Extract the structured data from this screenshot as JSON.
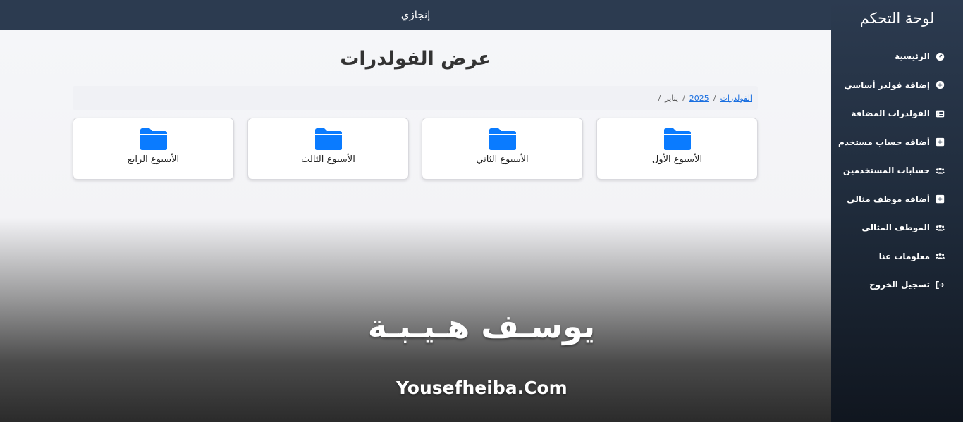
{
  "sidebar": {
    "title": "لوحة التحكم",
    "items": [
      {
        "label": "الرئيسية",
        "icon": "dashboard-icon"
      },
      {
        "label": "إضافة فولدر أساسي",
        "icon": "plus-circle-icon"
      },
      {
        "label": "الفولدرات المضافة",
        "icon": "list-icon"
      },
      {
        "label": "أضافه حساب مستخدم",
        "icon": "plus-square-icon"
      },
      {
        "label": "حسابات المستخدمين",
        "icon": "users-icon"
      },
      {
        "label": "أضافه موظف مثالي",
        "icon": "plus-square-icon"
      },
      {
        "label": "الموظف المثالي",
        "icon": "users-icon"
      },
      {
        "label": "معلومات عنا",
        "icon": "users-icon"
      },
      {
        "label": "تسجيل الخروج",
        "icon": "logout-icon"
      }
    ]
  },
  "topbar": {
    "title": "إنجازي"
  },
  "main": {
    "title": "عرض الفولدرات",
    "breadcrumb": [
      {
        "label": "الفولدرات",
        "link": true
      },
      {
        "label": "2025",
        "link": true
      },
      {
        "label": "يناير",
        "link": false
      }
    ],
    "folders": [
      {
        "label": "الأسبوع الأول"
      },
      {
        "label": "الأسبوع الثاني"
      },
      {
        "label": "الأسبوع الثالث"
      },
      {
        "label": "الأسبوع الرابع"
      }
    ]
  },
  "watermark": {
    "arabic": "يوسـف هـيـبـة",
    "english": "Yousefheiba.Com"
  },
  "colors": {
    "sidebar": "#2c3b50",
    "accent": "#0a7bff",
    "link": "#1a6fe0"
  }
}
